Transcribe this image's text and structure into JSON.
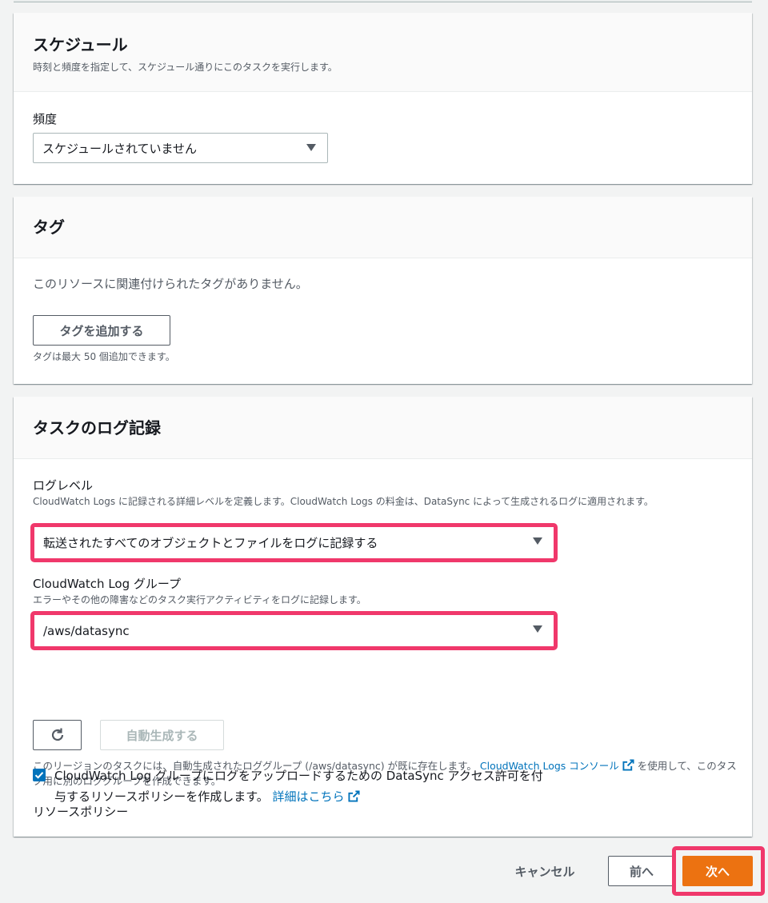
{
  "schedule": {
    "title": "スケジュール",
    "description": "時刻と頻度を指定して、スケジュール通りにこのタスクを実行します。",
    "frequency_label": "頻度",
    "frequency_value": "スケジュールされていません"
  },
  "tags": {
    "title": "タグ",
    "empty_text": "このリソースに関連付けられたタグがありません。",
    "add_button": "タグを追加する",
    "hint": "タグは最大 50 個追加できます。"
  },
  "logging": {
    "title": "タスクのログ記録",
    "log_level_label": "ログレベル",
    "log_level_desc": "CloudWatch Logs に記録される詳細レベルを定義します。CloudWatch Logs の料金は、DataSync によって生成されるログに適用されます。",
    "log_level_value": "転送されたすべてのオブジェクトとファイルをログに記録する",
    "log_group_label": "CloudWatch Log グループ",
    "log_group_desc": "エラーやその他の障害などのタスク実行アクティビティをログに記録します。",
    "log_group_value": "/aws/datasync",
    "refresh_icon": "refresh-icon",
    "autogen_button": "自動生成する",
    "region_note_1": "このリージョンのタスクには、自動生成されたロググループ (/aws/datasync) が既に存在します。",
    "region_note_link": "CloudWatch Logs コンソール",
    "region_note_2": "を使用して、このタスク用に別のロググループを作成できます。",
    "policy_label": "リソースポリシー",
    "policy_checked": true,
    "policy_text": "CloudWatch Log グループにログをアップロードするための DataSync アクセス許可を付与するリソースポリシーを作成します。",
    "policy_link": "詳細はこちら"
  },
  "footer": {
    "cancel": "キャンセル",
    "previous": "前へ",
    "next": "次へ"
  },
  "colors": {
    "accent": "#ec7211",
    "link": "#0073bb",
    "highlight": "#f0386b"
  }
}
